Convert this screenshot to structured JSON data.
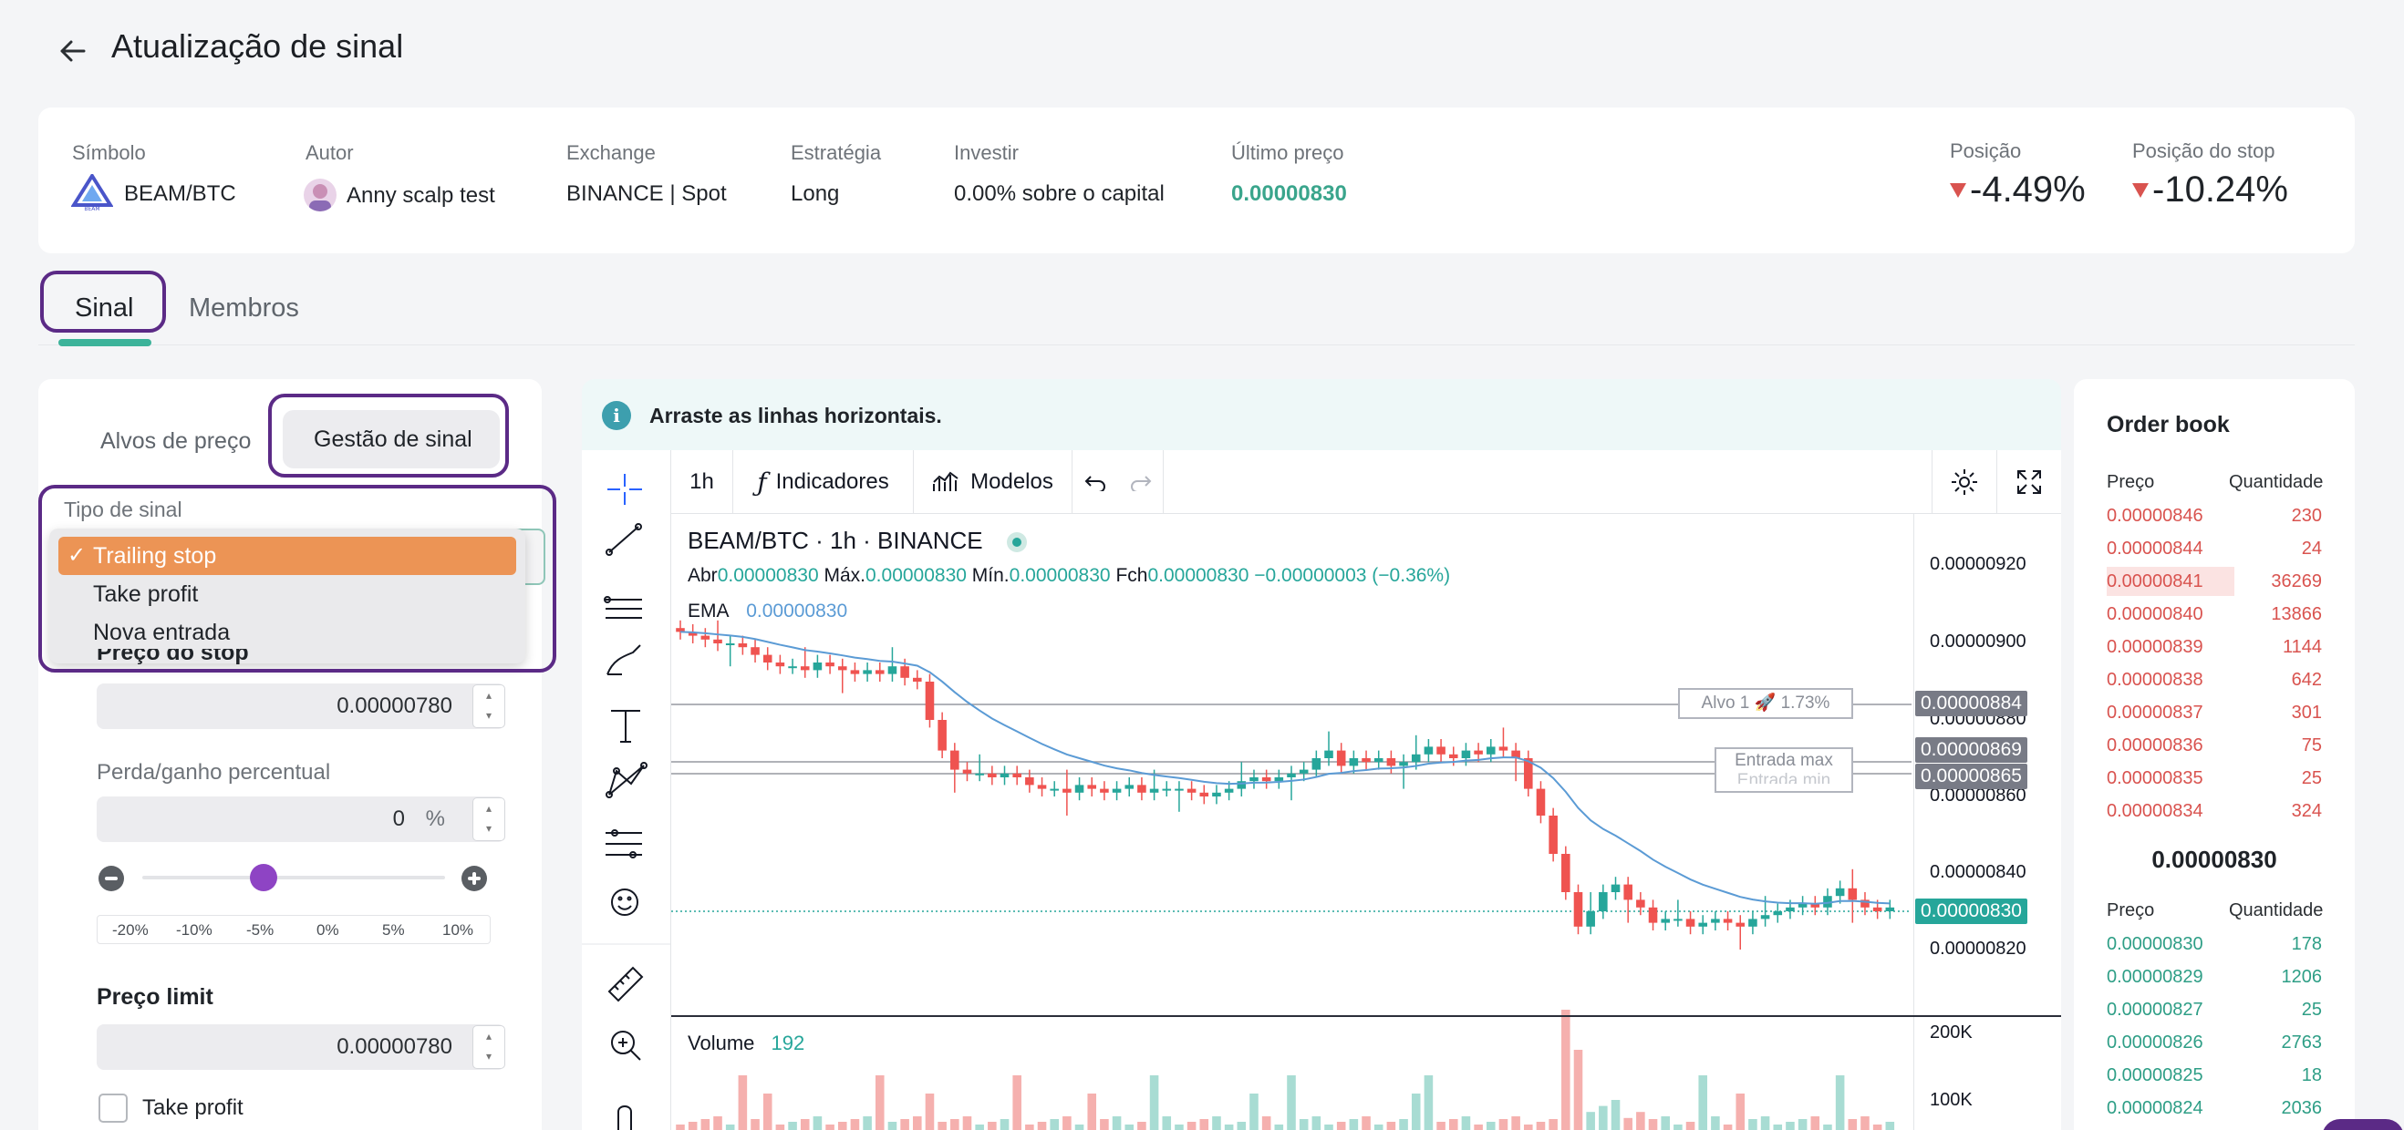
{
  "header": {
    "title": "Atualização de sinal"
  },
  "info": {
    "symbol_label": "Símbolo",
    "symbol": "BEAM/BTC",
    "author_label": "Autor",
    "author": "Anny scalp test",
    "exchange_label": "Exchange",
    "exchange": "BINANCE | Spot",
    "strategy_label": "Estratégia",
    "strategy": "Long",
    "invest_label": "Investir",
    "invest": "0.00% sobre o capital",
    "last_price_label": "Último preço",
    "last_price": "0.00000830",
    "position_label": "Posição",
    "position": "-4.49%",
    "stop_position_label": "Posição do stop",
    "stop_position": "-10.24%"
  },
  "tabs": [
    {
      "label": "Sinal"
    },
    {
      "label": "Membros"
    }
  ],
  "left": {
    "subtab_targets": "Alvos de preço",
    "subtab_management": "Gestão de sinal",
    "signal_type_label": "Tipo de sinal",
    "dropdown_options": [
      "Trailing stop",
      "Take profit",
      "Nova entrada"
    ],
    "stop_price_label": "Preço do stop",
    "stop_price": "0.00000780",
    "percent_label": "Perda/ganho percentual",
    "percent_value": "0",
    "percent_unit": "%",
    "slider_ticks": [
      "-20%",
      "-10%",
      "-5%",
      "0%",
      "5%",
      "10%"
    ],
    "slider_value_pct": -5,
    "limit_label": "Preço limit",
    "limit_price": "0.00000780",
    "take_profit_label": "Take profit"
  },
  "chart": {
    "info_text": "Arraste as linhas horizontais.",
    "interval": "1h",
    "indicators": "Indicadores",
    "templates": "Modelos",
    "legend_title": "BEAM/BTC · 1h · BINANCE",
    "ohlc": {
      "open_label": "Abr",
      "open": "0.00000830",
      "high_label": "Máx.",
      "high": "0.00000830",
      "low_label": "Mín.",
      "low": "0.00000830",
      "close_label": "Fch",
      "close": "0.00000830",
      "change": "−0.00000003 (−0.36%)"
    },
    "ema_label": "EMA",
    "ema_value": "0.00000830",
    "price_ticks": [
      "0.00000920",
      "0.00000900",
      "0.00000880",
      "0.00000860",
      "0.00000840",
      "0.00000820"
    ],
    "price_tags": [
      {
        "value": "0.00000884",
        "color": "#787b86"
      },
      {
        "value": "0.00000869",
        "color": "#787b86"
      },
      {
        "value": "0.00000865",
        "color": "#787b86"
      },
      {
        "value": "0.00000830",
        "color": "#26a69a"
      }
    ],
    "line_labels": {
      "target": "Alvo 1 🚀 1.73%",
      "entry_max": "Entrada max",
      "entry_min": "Entrada min"
    },
    "volume_label": "Volume",
    "volume_value": "192",
    "volume_ticks": [
      "200K",
      "100K"
    ],
    "colors": {
      "up": "#26a69a",
      "down": "#ef5350",
      "ema": "#5b9bd5"
    }
  },
  "orderbook": {
    "title": "Order book",
    "price_col": "Preço",
    "qty_col": "Quantidade",
    "asks": [
      {
        "price": "0.00000846",
        "qty": "230"
      },
      {
        "price": "0.00000844",
        "qty": "24"
      },
      {
        "price": "0.00000841",
        "qty": "36269"
      },
      {
        "price": "0.00000840",
        "qty": "13866"
      },
      {
        "price": "0.00000839",
        "qty": "1144"
      },
      {
        "price": "0.00000838",
        "qty": "642"
      },
      {
        "price": "0.00000837",
        "qty": "301"
      },
      {
        "price": "0.00000836",
        "qty": "75"
      },
      {
        "price": "0.00000835",
        "qty": "25"
      },
      {
        "price": "0.00000834",
        "qty": "324"
      }
    ],
    "mid_price": "0.00000830",
    "bids": [
      {
        "price": "0.00000830",
        "qty": "178"
      },
      {
        "price": "0.00000829",
        "qty": "1206"
      },
      {
        "price": "0.00000827",
        "qty": "25"
      },
      {
        "price": "0.00000826",
        "qty": "2763"
      },
      {
        "price": "0.00000825",
        "qty": "18"
      },
      {
        "price": "0.00000824",
        "qty": "2036"
      }
    ]
  }
}
